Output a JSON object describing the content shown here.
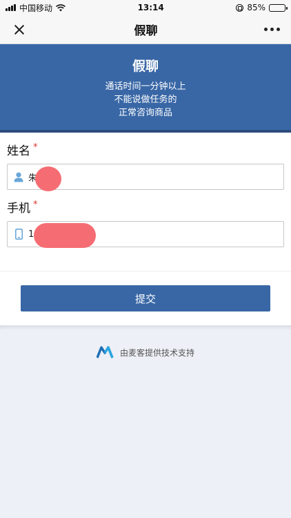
{
  "status_bar": {
    "carrier": "中国移动",
    "time": "13:14",
    "battery_percent": "85%",
    "battery_level": 0.85
  },
  "nav": {
    "title": "假聊"
  },
  "banner": {
    "title": "假聊",
    "lines": [
      "通话时间一分钟以上",
      "不能说做任务的",
      "正常咨询商品"
    ]
  },
  "form": {
    "name_label": "姓名",
    "name_value": "朱",
    "phone_label": "手机",
    "phone_value": "1",
    "required_mark": "*"
  },
  "submit_label": "提交",
  "footer_text": "由麦客提供技术支持",
  "colors": {
    "accent": "#3967a6",
    "required": "#d9342b",
    "redaction": "#f56d73"
  }
}
